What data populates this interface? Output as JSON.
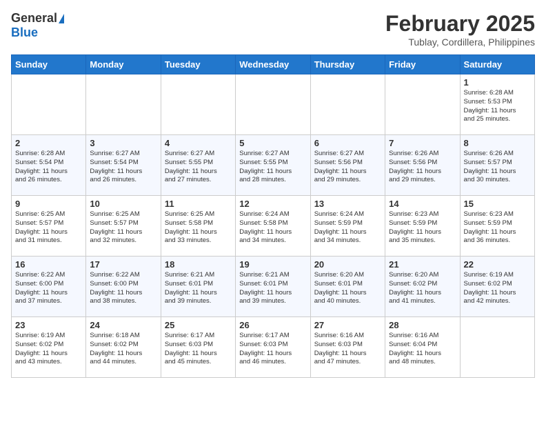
{
  "logo": {
    "general": "General",
    "blue": "Blue"
  },
  "title": "February 2025",
  "subtitle": "Tublay, Cordillera, Philippines",
  "days_of_week": [
    "Sunday",
    "Monday",
    "Tuesday",
    "Wednesday",
    "Thursday",
    "Friday",
    "Saturday"
  ],
  "weeks": [
    [
      {
        "day": "",
        "info": ""
      },
      {
        "day": "",
        "info": ""
      },
      {
        "day": "",
        "info": ""
      },
      {
        "day": "",
        "info": ""
      },
      {
        "day": "",
        "info": ""
      },
      {
        "day": "",
        "info": ""
      },
      {
        "day": "1",
        "info": "Sunrise: 6:28 AM\nSunset: 5:53 PM\nDaylight: 11 hours\nand 25 minutes."
      }
    ],
    [
      {
        "day": "2",
        "info": "Sunrise: 6:28 AM\nSunset: 5:54 PM\nDaylight: 11 hours\nand 26 minutes."
      },
      {
        "day": "3",
        "info": "Sunrise: 6:27 AM\nSunset: 5:54 PM\nDaylight: 11 hours\nand 26 minutes."
      },
      {
        "day": "4",
        "info": "Sunrise: 6:27 AM\nSunset: 5:55 PM\nDaylight: 11 hours\nand 27 minutes."
      },
      {
        "day": "5",
        "info": "Sunrise: 6:27 AM\nSunset: 5:55 PM\nDaylight: 11 hours\nand 28 minutes."
      },
      {
        "day": "6",
        "info": "Sunrise: 6:27 AM\nSunset: 5:56 PM\nDaylight: 11 hours\nand 29 minutes."
      },
      {
        "day": "7",
        "info": "Sunrise: 6:26 AM\nSunset: 5:56 PM\nDaylight: 11 hours\nand 29 minutes."
      },
      {
        "day": "8",
        "info": "Sunrise: 6:26 AM\nSunset: 5:57 PM\nDaylight: 11 hours\nand 30 minutes."
      }
    ],
    [
      {
        "day": "9",
        "info": "Sunrise: 6:25 AM\nSunset: 5:57 PM\nDaylight: 11 hours\nand 31 minutes."
      },
      {
        "day": "10",
        "info": "Sunrise: 6:25 AM\nSunset: 5:57 PM\nDaylight: 11 hours\nand 32 minutes."
      },
      {
        "day": "11",
        "info": "Sunrise: 6:25 AM\nSunset: 5:58 PM\nDaylight: 11 hours\nand 33 minutes."
      },
      {
        "day": "12",
        "info": "Sunrise: 6:24 AM\nSunset: 5:58 PM\nDaylight: 11 hours\nand 34 minutes."
      },
      {
        "day": "13",
        "info": "Sunrise: 6:24 AM\nSunset: 5:59 PM\nDaylight: 11 hours\nand 34 minutes."
      },
      {
        "day": "14",
        "info": "Sunrise: 6:23 AM\nSunset: 5:59 PM\nDaylight: 11 hours\nand 35 minutes."
      },
      {
        "day": "15",
        "info": "Sunrise: 6:23 AM\nSunset: 5:59 PM\nDaylight: 11 hours\nand 36 minutes."
      }
    ],
    [
      {
        "day": "16",
        "info": "Sunrise: 6:22 AM\nSunset: 6:00 PM\nDaylight: 11 hours\nand 37 minutes."
      },
      {
        "day": "17",
        "info": "Sunrise: 6:22 AM\nSunset: 6:00 PM\nDaylight: 11 hours\nand 38 minutes."
      },
      {
        "day": "18",
        "info": "Sunrise: 6:21 AM\nSunset: 6:01 PM\nDaylight: 11 hours\nand 39 minutes."
      },
      {
        "day": "19",
        "info": "Sunrise: 6:21 AM\nSunset: 6:01 PM\nDaylight: 11 hours\nand 39 minutes."
      },
      {
        "day": "20",
        "info": "Sunrise: 6:20 AM\nSunset: 6:01 PM\nDaylight: 11 hours\nand 40 minutes."
      },
      {
        "day": "21",
        "info": "Sunrise: 6:20 AM\nSunset: 6:02 PM\nDaylight: 11 hours\nand 41 minutes."
      },
      {
        "day": "22",
        "info": "Sunrise: 6:19 AM\nSunset: 6:02 PM\nDaylight: 11 hours\nand 42 minutes."
      }
    ],
    [
      {
        "day": "23",
        "info": "Sunrise: 6:19 AM\nSunset: 6:02 PM\nDaylight: 11 hours\nand 43 minutes."
      },
      {
        "day": "24",
        "info": "Sunrise: 6:18 AM\nSunset: 6:02 PM\nDaylight: 11 hours\nand 44 minutes."
      },
      {
        "day": "25",
        "info": "Sunrise: 6:17 AM\nSunset: 6:03 PM\nDaylight: 11 hours\nand 45 minutes."
      },
      {
        "day": "26",
        "info": "Sunrise: 6:17 AM\nSunset: 6:03 PM\nDaylight: 11 hours\nand 46 minutes."
      },
      {
        "day": "27",
        "info": "Sunrise: 6:16 AM\nSunset: 6:03 PM\nDaylight: 11 hours\nand 47 minutes."
      },
      {
        "day": "28",
        "info": "Sunrise: 6:16 AM\nSunset: 6:04 PM\nDaylight: 11 hours\nand 48 minutes."
      },
      {
        "day": "",
        "info": ""
      }
    ]
  ]
}
